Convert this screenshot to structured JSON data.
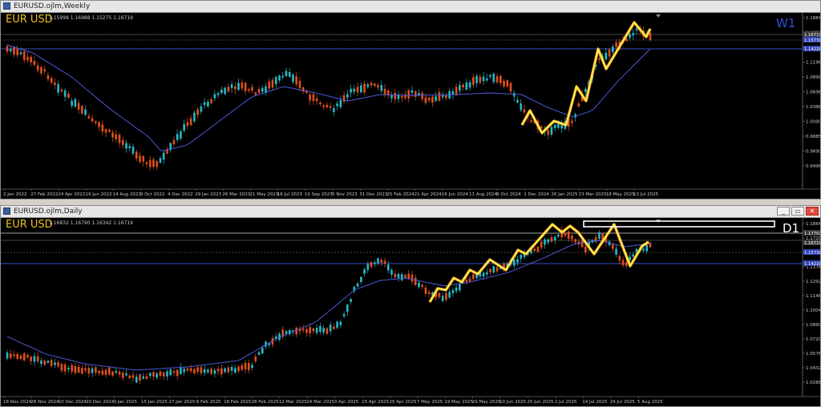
{
  "window_weekly": {
    "title": "EURUSD.ojlm,Weekly",
    "ohlc": "1.15998 1.16988 1.15275 1.16719",
    "symbol_label": "EUR USD",
    "timeframe_label": "W1",
    "timeframe_color": "#3050d8",
    "price_labels": [
      "1.16719",
      "1.15738",
      "1.14228"
    ],
    "axis_prices": [
      "1.18848",
      "1.16920",
      "1.13880",
      "1.11968",
      "1.08905",
      "1.06960",
      "1.03880",
      "1.00905",
      "0.98850",
      "0.96900",
      "0.94960"
    ],
    "date_labels": [
      "2 Jan 2022",
      "27 Feb 2022",
      "24 Apr 2022",
      "19 Jun 2022",
      "14 Aug 2022",
      "9 Oct 2022",
      "4 Dec 2022",
      "29 Jan 2023",
      "26 Mar 2023",
      "21 May 2023",
      "16 Jul 2023",
      "10 Sep 2023",
      "5 Nov 2023",
      "31 Dec 2023",
      "25 Feb 2024",
      "21 Apr 2024",
      "16 Jun 2024",
      "11 Aug 2024",
      "6 Oct 2024",
      "1 Dec 2024",
      "26 Jan 2025",
      "23 Mar 2025",
      "18 May 2025",
      "13 Jul 2025"
    ]
  },
  "window_daily": {
    "title": "EURUSD.ojlm,Daily",
    "ohlc": "1.16832 1.16790 1.16342 1.16719",
    "symbol_label": "EUR USD",
    "timeframe_label": "D1",
    "timeframe_color": "#ffffff",
    "price_labels": [
      "1.17703",
      "1.16719",
      "1.15738",
      "1.14228"
    ],
    "axis_prices": [
      "1.18840",
      "1.17200",
      "1.15480",
      "1.13760",
      "1.12920",
      "1.11480",
      "1.10040",
      "1.08600",
      "1.07200",
      "1.05760",
      "1.04320",
      "1.02880",
      "1.01840"
    ],
    "date_labels": [
      "18 Nov 2024",
      "28 Nov 2024",
      "10 Dec 2024",
      "20 Dec 2024",
      "3 Jan 2025",
      "15 Jan 2025",
      "27 Jan 2025",
      "6 Feb 2025",
      "18 Feb 2025",
      "28 Feb 2025",
      "12 Mar 2025",
      "24 Mar 2025",
      "3 Apr 2025",
      "15 Apr 2025",
      "25 Apr 2025",
      "7 May 2025",
      "19 May 2025",
      "29 May 2025",
      "10 Jun 2025",
      "20 Jun 2025",
      "2 Jul 2025",
      "14 Jul 2025",
      "24 Jul 2025",
      "5 Aug 2025"
    ]
  },
  "window_buttons": [
    "_",
    "▭",
    "✕"
  ],
  "colors": {
    "bull": "#26b8c8",
    "bear": "#e0501c",
    "ma": "#4a5ad8",
    "zigzag": "#f2ee50",
    "zigzag_outline": "#ff9a20",
    "level": "#3a50c0",
    "label_bg": "#3044b8"
  }
}
